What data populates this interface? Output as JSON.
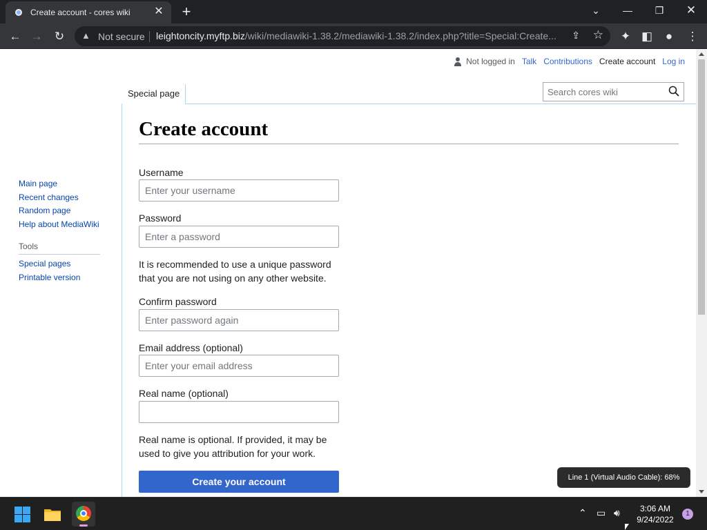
{
  "browser": {
    "tab_title": "Create account - cores wiki",
    "new_tab_glyph": "+",
    "address": {
      "security": "Not secure",
      "host": "leightoncity.myftp.biz",
      "path": "/wiki/mediawiki-1.38.2/mediawiki-1.38.2/index.php?title=Special:Create..."
    }
  },
  "personal": {
    "status": "Not logged in",
    "talk": "Talk",
    "contributions": "Contributions",
    "create_account": "Create account",
    "log_in": "Log in"
  },
  "tabs": {
    "special_page": "Special page"
  },
  "search": {
    "placeholder": "Search cores wiki"
  },
  "sidebar": {
    "nav": [
      "Main page",
      "Recent changes",
      "Random page",
      "Help about MediaWiki"
    ],
    "tools_heading": "Tools",
    "tools": [
      "Special pages",
      "Printable version"
    ]
  },
  "form": {
    "heading": "Create account",
    "username_label": "Username",
    "username_placeholder": "Enter your username",
    "password_label": "Password",
    "password_placeholder": "Enter a password",
    "password_help": "It is recommended to use a unique password that you are not using on any other website.",
    "confirm_label": "Confirm password",
    "confirm_placeholder": "Enter password again",
    "email_label": "Email address (optional)",
    "email_placeholder": "Enter your email address",
    "realname_label": "Real name (optional)",
    "realname_placeholder": "",
    "realname_help": "Real name is optional. If provided, it may be used to give you attribution for your work.",
    "submit": "Create your account"
  },
  "tooltip": "Line 1 (Virtual Audio Cable): 68%",
  "taskbar": {
    "time": "3:06 AM",
    "date": "9/24/2022",
    "notifications": "1"
  },
  "colors": {
    "link": "#0645ad",
    "primary_button": "#3366cc",
    "chrome_dark": "#202124"
  }
}
